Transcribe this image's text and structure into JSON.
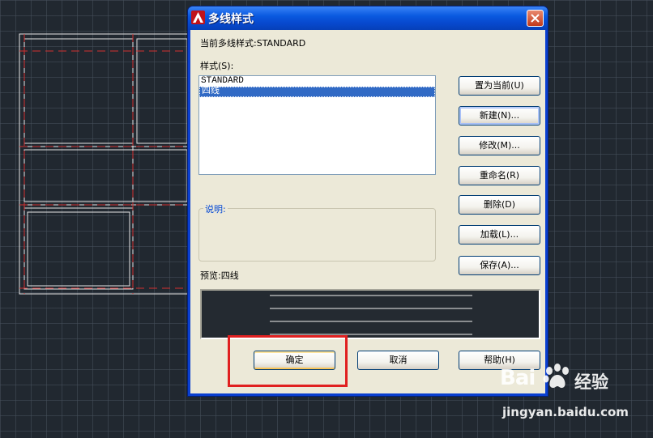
{
  "dialog": {
    "title": "多线样式",
    "current_style_label": "当前多线样式:STANDARD",
    "styles_label": "样式(S):",
    "styles": [
      "STANDARD",
      "四线"
    ],
    "selected_style": "四线",
    "description_label": "说明:",
    "preview_label": "预览:四线",
    "preview_line_count": 4
  },
  "buttons": {
    "set_current": "置为当前(U)",
    "new": "新建(N)...",
    "modify": "修改(M)...",
    "rename": "重命名(R)",
    "delete": "删除(D)",
    "load": "加载(L)...",
    "save": "保存(A)...",
    "ok": "确定",
    "cancel": "取消",
    "help": "帮助(H)"
  },
  "watermark": {
    "brand": "Bai",
    "brand_suffix": "经验",
    "url": "jingyan.baidu.com"
  },
  "colors": {
    "cad_background": "#212830",
    "xp_titlebar": "#0a5ae0",
    "selection": "#316ac5",
    "highlight_box": "#e02020",
    "preview_background": "#242a31"
  }
}
